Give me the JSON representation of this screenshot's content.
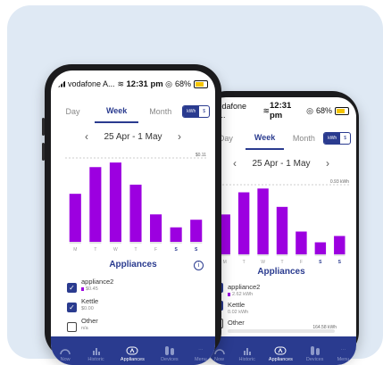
{
  "status": {
    "carrier": "vodafone A...",
    "time": "12:31 pm",
    "battery": "68%"
  },
  "tabs": [
    {
      "label": "Day"
    },
    {
      "label": "Week",
      "active": true
    },
    {
      "label": "Month"
    }
  ],
  "unit_toggle": {
    "off_label": "kWh",
    "on_label": "$"
  },
  "date_range": "25 Apr - 1 May",
  "front": {
    "max_label": "$0.11",
    "appliances_title": "Appliances",
    "items": [
      {
        "name": "appliance2",
        "value": "$0.45",
        "checked": true
      },
      {
        "name": "Kettle",
        "value": "$0.00",
        "checked": true
      },
      {
        "name": "Other",
        "value": "n/a",
        "checked": false
      }
    ]
  },
  "back": {
    "max_label": "0.93 kWh",
    "appliances_title": "Appliances",
    "items": [
      {
        "name": "appliance2",
        "value": "2.62 kWh",
        "checked": true
      },
      {
        "name": "Kettle",
        "value": "0.02 kWh",
        "checked": true
      },
      {
        "name": "Other",
        "value": "164.58 kWh",
        "checked": false
      }
    ]
  },
  "chart_data": {
    "type": "bar",
    "categories": [
      "M",
      "T",
      "W",
      "T",
      "F",
      "S",
      "S"
    ],
    "values": [
      0.063,
      0.098,
      0.104,
      0.075,
      0.036,
      0.019,
      0.029
    ],
    "ylim": [
      0,
      0.11
    ],
    "color": "#9c00e0"
  },
  "nav": [
    {
      "label": "Now",
      "icon": "gauge-icon"
    },
    {
      "label": "Historic",
      "icon": "bar-chart-icon"
    },
    {
      "label": "Appliances",
      "icon": "plug-icon",
      "active": true
    },
    {
      "label": "Devices",
      "icon": "devices-icon"
    },
    {
      "label": "Menu",
      "icon": "more-icon"
    }
  ],
  "colors": {
    "primary": "#2a3b8f",
    "bar": "#9c00e0",
    "background": "#dfe9f4"
  }
}
